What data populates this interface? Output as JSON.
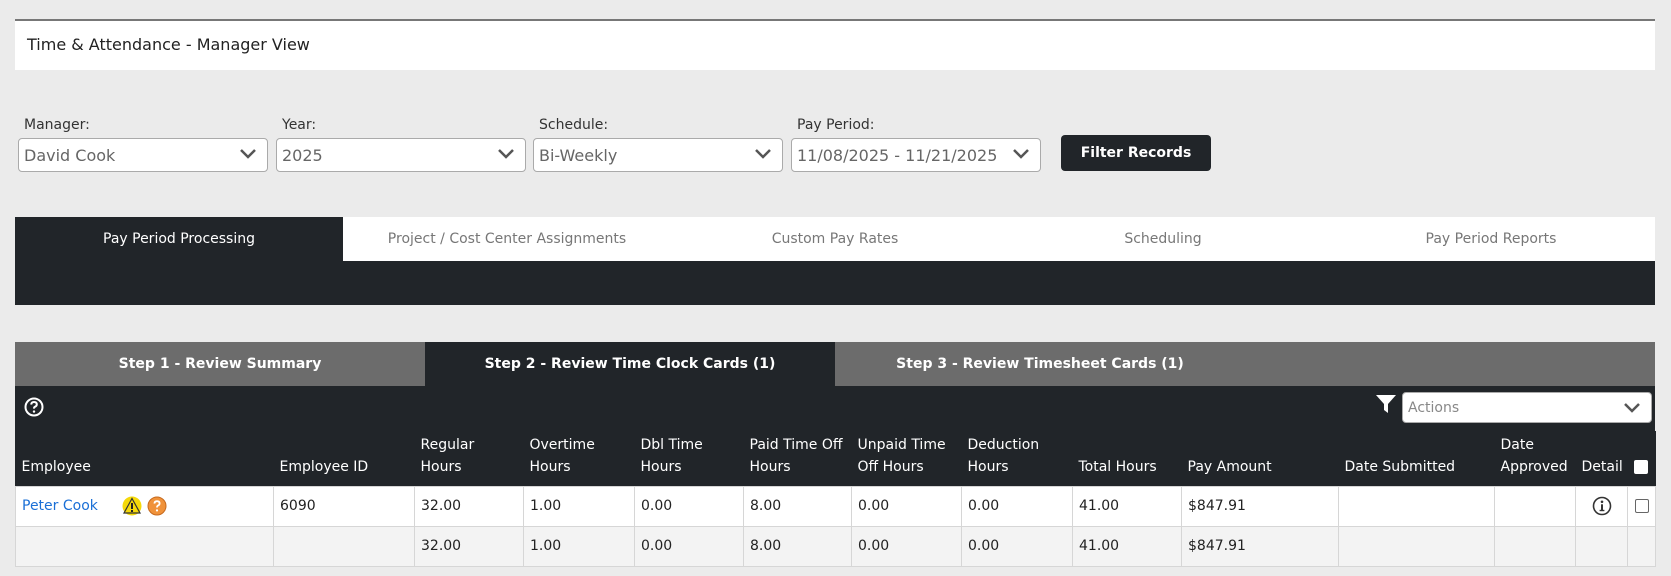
{
  "page": {
    "title": "Time & Attendance - Manager View"
  },
  "filters": {
    "manager": {
      "label": "Manager:",
      "value": "David Cook"
    },
    "year": {
      "label": "Year:",
      "value": "2025"
    },
    "schedule": {
      "label": "Schedule:",
      "value": "Bi-Weekly"
    },
    "pay_period": {
      "label": "Pay Period:",
      "value": "11/08/2025 - 11/21/2025"
    },
    "filter_button": "Filter Records"
  },
  "main_tabs": [
    {
      "label": "Pay Period Processing",
      "active": true
    },
    {
      "label": "Project / Cost Center Assignments",
      "active": false
    },
    {
      "label": "Custom Pay Rates",
      "active": false
    },
    {
      "label": "Scheduling",
      "active": false
    },
    {
      "label": "Pay Period Reports",
      "active": false
    }
  ],
  "step_tabs": [
    {
      "label": "Step 1 - Review Summary",
      "active": false
    },
    {
      "label": "Step 2 - Review Time Clock Cards (1)",
      "active": true
    },
    {
      "label": "Step 3 - Review Timesheet Cards (1)",
      "active": false
    }
  ],
  "toolbar": {
    "actions_placeholder": "Actions"
  },
  "table": {
    "headers": {
      "employee": "Employee",
      "employee_id": "Employee ID",
      "regular": "Regular Hours",
      "overtime": "Overtime Hours",
      "dbl_time": "Dbl Time Hours",
      "pto": "Paid Time Off Hours",
      "unpaid": "Unpaid Time Off Hours",
      "deduction": "Deduction Hours",
      "total": "Total Hours",
      "pay": "Pay Amount",
      "submitted": "Date Submitted",
      "approved": "Date Approved",
      "detail": "Detail"
    },
    "rows": [
      {
        "employee": "Peter Cook",
        "employee_id": "6090",
        "regular": "32.00",
        "overtime": "1.00",
        "dbl_time": "0.00",
        "pto": "8.00",
        "unpaid": "0.00",
        "deduction": "0.00",
        "total": "41.00",
        "pay": "$847.91",
        "submitted": "",
        "approved": ""
      }
    ],
    "totals": {
      "regular": "32.00",
      "overtime": "1.00",
      "dbl_time": "0.00",
      "pto": "8.00",
      "unpaid": "0.00",
      "deduction": "0.00",
      "total": "41.00",
      "pay": "$847.91"
    }
  },
  "colors": {
    "dark": "#212529",
    "step_gray": "#6c6c6c",
    "link": "#1a6fd6",
    "warning": "#f5d90a",
    "question_orange": "#f0923a"
  }
}
